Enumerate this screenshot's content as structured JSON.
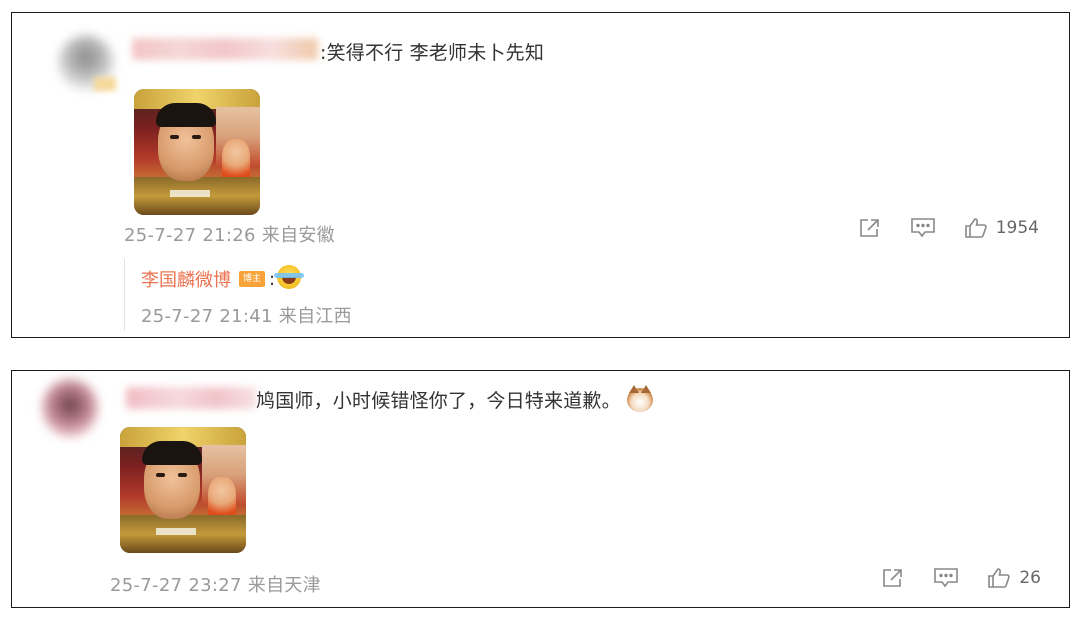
{
  "comments": [
    {
      "text": ":笑得不行 李老师未卜先知",
      "emoji": "",
      "timestamp_location": "25-7-27 21:26 来自安徽",
      "like_count": "1954",
      "image_icon": "drama-still-image",
      "reply": {
        "name": "李国麟微博",
        "badge": "博主",
        "colon": ":",
        "emoji": "laughing-tears-emoji",
        "timestamp_location": "25-7-27 21:41 来自江西"
      }
    },
    {
      "text": "鸠国师，小时候错怪你了，今日特来道歉。",
      "emoji": "cat-emoji",
      "timestamp_location": "25-7-27 23:27 来自天津",
      "like_count": "26",
      "image_icon": "drama-still-image"
    }
  ],
  "icons": {
    "share": "share-icon",
    "comment": "comment-icon",
    "like": "thumbs-up-icon"
  },
  "colors": {
    "reply_name": "#eb7350",
    "badge": "#f7a33a",
    "meta_gray": "#9a9a9a",
    "border": "#1a1a1a"
  }
}
